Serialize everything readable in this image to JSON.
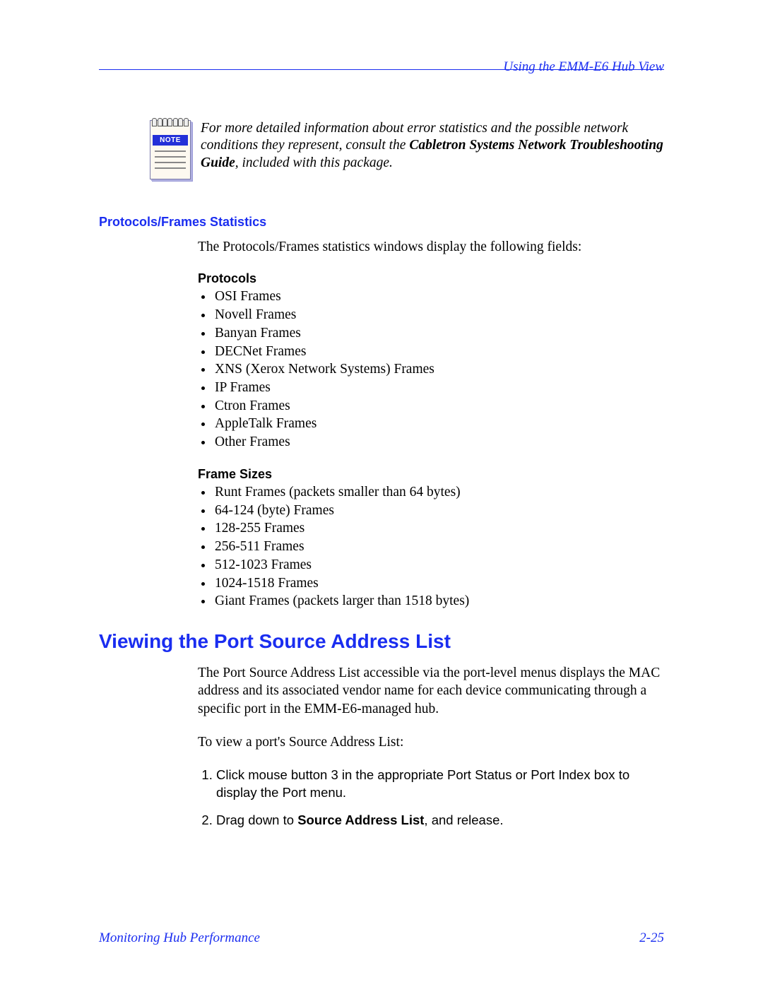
{
  "header": {
    "right": "Using the EMM-E6 Hub View"
  },
  "note": {
    "badge": "NOTE",
    "text_a": "For more detailed information about error statistics and the possible network conditions they represent, consult the ",
    "text_bold": "Cabletron Systems Network Troubleshooting Guide",
    "text_b": ", included with this package."
  },
  "section": {
    "title": "Protocols/Frames Statistics",
    "intro": "The Protocols/Frames statistics windows display the following fields:"
  },
  "protocols": {
    "heading": "Protocols",
    "items": [
      "OSI Frames",
      "Novell Frames",
      "Banyan Frames",
      "DECNet Frames",
      "XNS (Xerox Network Systems) Frames",
      "IP Frames",
      "Ctron Frames",
      "AppleTalk Frames",
      "Other Frames"
    ]
  },
  "frame_sizes": {
    "heading": "Frame Sizes",
    "items": [
      "Runt Frames (packets smaller than 64 bytes)",
      "64-124 (byte) Frames",
      "128-255 Frames",
      "256-511 Frames",
      "512-1023 Frames",
      "1024-1518 Frames",
      "Giant Frames (packets larger than 1518 bytes)"
    ]
  },
  "h2": "Viewing the Port Source Address List",
  "addr_para1": "The Port Source Address List accessible via the port-level menus displays the MAC address and its associated vendor name for each device communicating through a specific port in the EMM-E6-managed hub.",
  "addr_para2": "To view a port's Source Address List:",
  "steps": [
    {
      "pre": "Click mouse button 3 in the appropriate Port Status or Port Index box to display the Port menu.",
      "bold": "",
      "post": ""
    },
    {
      "pre": "Drag down to ",
      "bold": "Source Address List",
      "post": ", and release."
    }
  ],
  "footer": {
    "left": "Monitoring Hub Performance",
    "right": "2-25"
  }
}
